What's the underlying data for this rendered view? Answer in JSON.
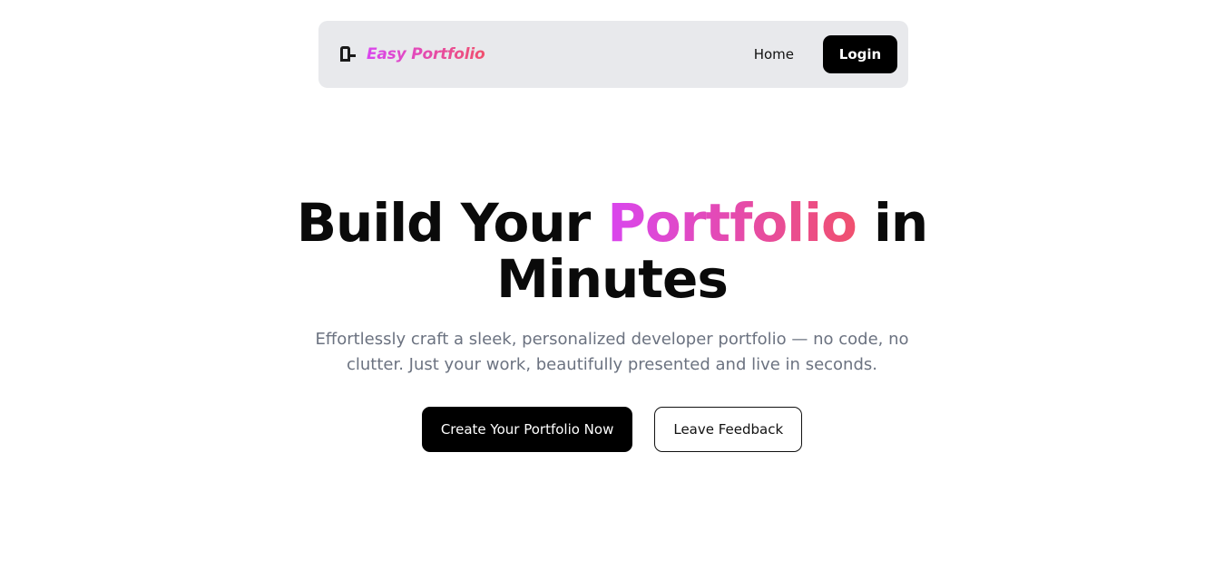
{
  "navbar": {
    "brand": {
      "icon": "logo-icon",
      "name": "Easy Portfolio"
    },
    "links": {
      "home": "Home"
    },
    "login_label": "Login"
  },
  "hero": {
    "title_before": "Build Your ",
    "title_highlight": "Portfolio",
    "title_after": " in Minutes",
    "subtitle": "Effortlessly craft a sleek, personalized developer portfolio — no code, no clutter. Just your work, beautifully presented and live in seconds.",
    "primary_cta": "Create Your Portfolio Now",
    "secondary_cta": "Leave Feedback"
  },
  "colors": {
    "gradient_start": "#d946ef",
    "gradient_end": "#f0506e",
    "navbar_bg": "#e8e9ec",
    "button_bg": "#000000",
    "subtitle_text": "#6b7280"
  }
}
